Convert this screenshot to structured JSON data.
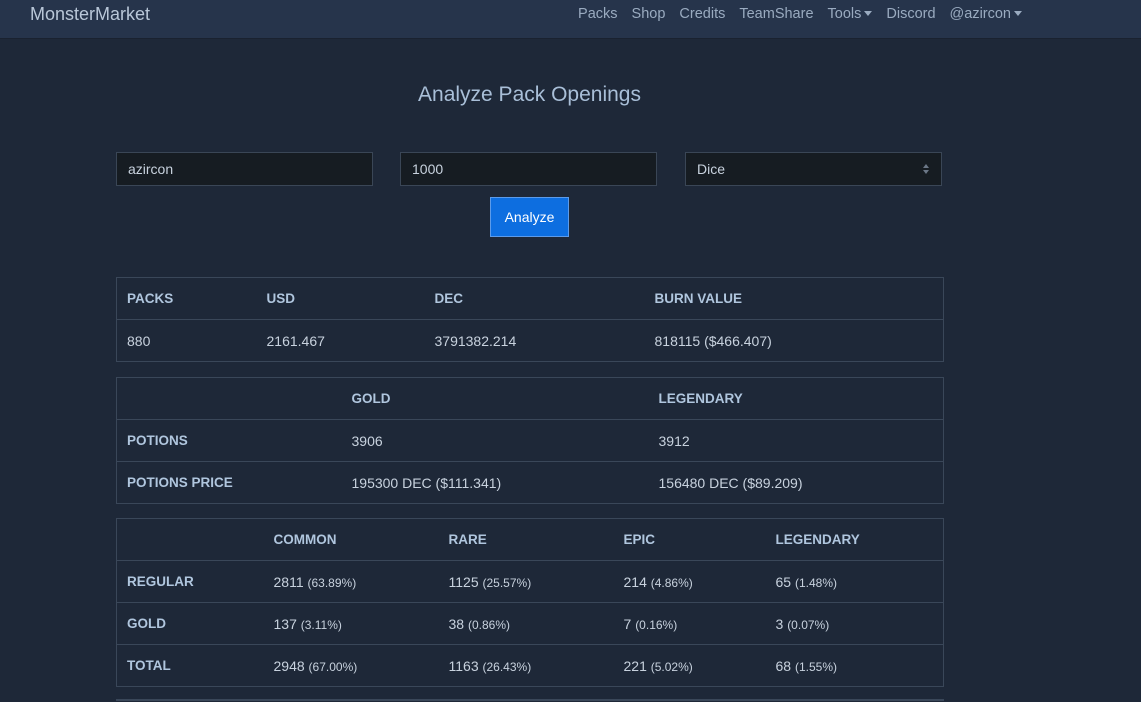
{
  "brand": "MonsterMarket",
  "nav": {
    "packs": "Packs",
    "shop": "Shop",
    "credits": "Credits",
    "teamshare": "TeamShare",
    "tools": "Tools",
    "discord": "Discord",
    "user": "@azircon"
  },
  "title": "Analyze Pack Openings",
  "form": {
    "username": "azircon",
    "amount": "1000",
    "set": "Dice",
    "analyze_label": "Analyze"
  },
  "summary": {
    "headers": [
      "PACKS",
      "USD",
      "DEC",
      "BURN VALUE"
    ],
    "values": [
      "880",
      "2161.467",
      "3791382.214",
      "818115 ($466.407)"
    ]
  },
  "potions": {
    "headers": [
      "",
      "GOLD",
      "LEGENDARY"
    ],
    "rows": [
      {
        "label": "POTIONS",
        "gold": "3906",
        "legendary": "3912"
      },
      {
        "label": "POTIONS PRICE",
        "gold": "195300 DEC ($111.341)",
        "legendary": "156480 DEC ($89.209)"
      }
    ]
  },
  "rarity": {
    "headers": [
      "",
      "COMMON",
      "RARE",
      "EPIC",
      "LEGENDARY"
    ],
    "rows": [
      {
        "label": "REGULAR",
        "common": "2811",
        "common_pct": "(63.89%)",
        "rare": "1125",
        "rare_pct": "(25.57%)",
        "epic": "214",
        "epic_pct": "(4.86%)",
        "legendary": "65",
        "legendary_pct": "(1.48%)"
      },
      {
        "label": "GOLD",
        "common": "137",
        "common_pct": "(3.11%)",
        "rare": "38",
        "rare_pct": "(0.86%)",
        "epic": "7",
        "epic_pct": "(0.16%)",
        "legendary": "3",
        "legendary_pct": "(0.07%)"
      },
      {
        "label": "TOTAL",
        "common": "2948",
        "common_pct": "(67.00%)",
        "rare": "1163",
        "rare_pct": "(26.43%)",
        "epic": "221",
        "epic_pct": "(5.02%)",
        "legendary": "68",
        "legendary_pct": "(1.55%)"
      }
    ]
  },
  "colors": {
    "background": "#1e2838",
    "navbar": "#26344b",
    "accent_button": "#0d6ee0",
    "header_text": "#b0c6de"
  }
}
